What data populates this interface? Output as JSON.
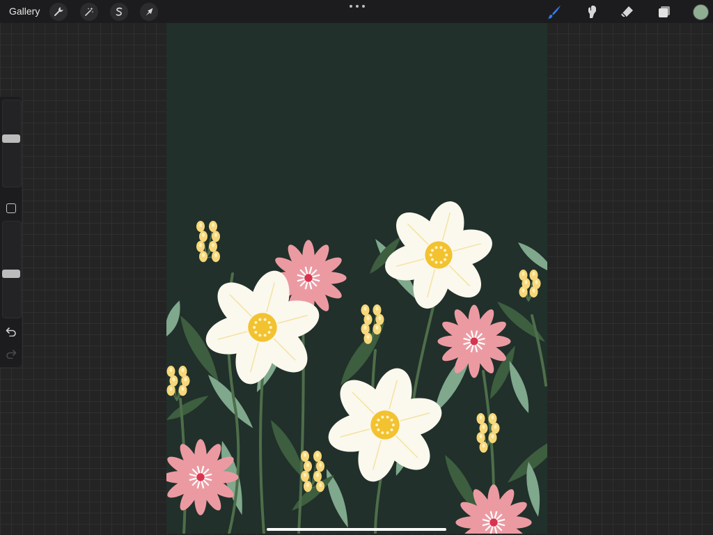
{
  "topbar": {
    "gallery_label": "Gallery",
    "left_tools": [
      "wrench-icon",
      "magic-wand-icon",
      "selection-icon",
      "transform-arrow-icon"
    ],
    "right_tools": [
      "brush-icon",
      "smudge-icon",
      "eraser-icon",
      "layers-icon"
    ],
    "active_tool": "brush-icon",
    "active_tool_color": "#2f7cf6",
    "current_color": "#8fae92"
  },
  "sidebar": {
    "brush_size_level": 0.55,
    "opacity_level": 0.55,
    "controls": [
      "modify-button",
      "undo-icon",
      "redo-icon"
    ]
  },
  "canvas": {
    "background_color": "#21302a",
    "palette": {
      "leaf_light": "#7fa88c",
      "leaf_dark": "#3d5e3f",
      "stem": "#4e6e4a",
      "white_petal": "#fbf8ee",
      "pink_petal": "#ec9aa2",
      "center_yellow": "#f2c230",
      "bud_yellow": "#f7d77a",
      "pink_center": "#d9344f"
    }
  }
}
